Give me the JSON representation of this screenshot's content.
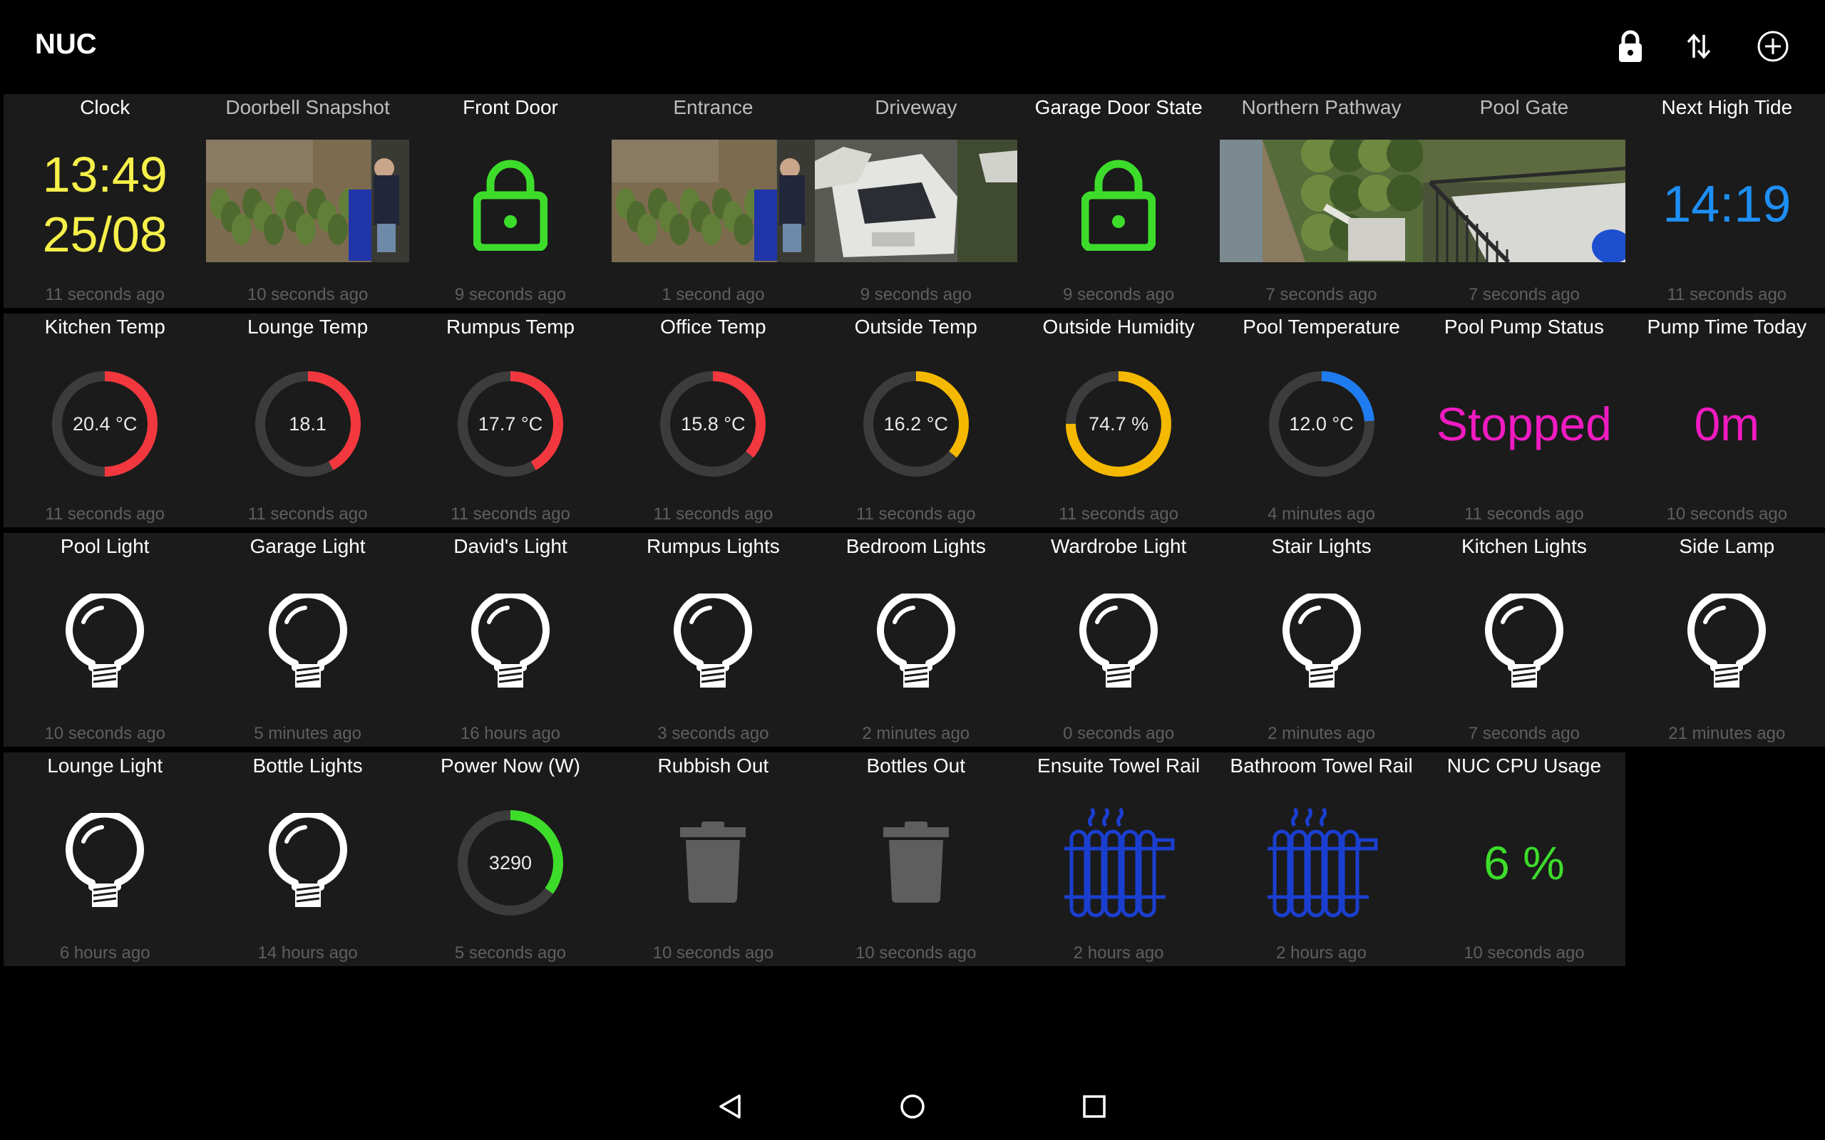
{
  "app": {
    "title": "NUC"
  },
  "toolbar": {
    "lock": "lock-icon",
    "sort": "swap-vertical-icon",
    "add": "plus-circle-icon"
  },
  "rows": [
    [
      {
        "type": "clock",
        "title": "Clock",
        "time": "13:49",
        "date": "25/08",
        "ago": "11 seconds ago",
        "color": "#f6f04a"
      },
      {
        "type": "camera",
        "title": "Doorbell Snapshot",
        "scene": "porch",
        "ago": "10 seconds ago"
      },
      {
        "type": "lock",
        "title": "Front Door",
        "state": "locked",
        "ago": "9 seconds ago",
        "color": "#3ddc2b"
      },
      {
        "type": "camera",
        "title": "Entrance",
        "scene": "porch",
        "ago": "1 second ago"
      },
      {
        "type": "camera",
        "title": "Driveway",
        "scene": "cars",
        "ago": "9 seconds ago"
      },
      {
        "type": "lock",
        "title": "Garage Door State",
        "state": "locked",
        "ago": "9 seconds ago",
        "color": "#3ddc2b"
      },
      {
        "type": "camera",
        "title": "Northern Pathway",
        "scene": "path",
        "ago": "7 seconds ago"
      },
      {
        "type": "camera",
        "title": "Pool Gate",
        "scene": "deck",
        "ago": "7 seconds ago"
      },
      {
        "type": "text",
        "title": "Next High Tide",
        "value": "14:19",
        "ago": "11 seconds ago",
        "color": "#1e8ff5",
        "size": 72
      }
    ],
    [
      {
        "type": "gauge",
        "title": "Kitchen Temp",
        "value": "20.4 °C",
        "fraction": 0.5,
        "color": "#f2383e",
        "ago": "11 seconds ago"
      },
      {
        "type": "gauge",
        "title": "Lounge Temp",
        "value": "18.1",
        "fraction": 0.42,
        "color": "#f2383e",
        "ago": "11 seconds ago"
      },
      {
        "type": "gauge",
        "title": "Rumpus Temp",
        "value": "17.7 °C",
        "fraction": 0.42,
        "color": "#f2383e",
        "ago": "11 seconds ago"
      },
      {
        "type": "gauge",
        "title": "Office Temp",
        "value": "15.8 °C",
        "fraction": 0.36,
        "color": "#f2383e",
        "ago": "11 seconds ago"
      },
      {
        "type": "gauge",
        "title": "Outside Temp",
        "value": "16.2 °C",
        "fraction": 0.36,
        "color": "#f5b800",
        "ago": "11 seconds ago"
      },
      {
        "type": "gauge",
        "title": "Outside Humidity",
        "value": "74.7 %",
        "fraction": 0.75,
        "color": "#f5b800",
        "ago": "11 seconds ago"
      },
      {
        "type": "gauge",
        "title": "Pool Temperature",
        "value": "12.0 °C",
        "fraction": 0.24,
        "color": "#1f7cf0",
        "ago": "4 minutes ago"
      },
      {
        "type": "text",
        "title": "Pool Pump Status",
        "value": "Stopped",
        "ago": "11 seconds ago",
        "color": "#f01bc0",
        "size": 66
      },
      {
        "type": "text",
        "title": "Pump Time Today",
        "value": "0m",
        "ago": "10 seconds ago",
        "color": "#f01bc0",
        "size": 66
      }
    ],
    [
      {
        "type": "bulb",
        "title": "Pool Light",
        "ago": "10 seconds ago"
      },
      {
        "type": "bulb",
        "title": "Garage Light",
        "ago": "5 minutes ago"
      },
      {
        "type": "bulb",
        "title": "David's Light",
        "ago": "16 hours ago"
      },
      {
        "type": "bulb",
        "title": "Rumpus Lights",
        "ago": "3 seconds ago"
      },
      {
        "type": "bulb",
        "title": "Bedroom Lights",
        "ago": "2 minutes ago"
      },
      {
        "type": "bulb",
        "title": "Wardrobe Light",
        "ago": "0 seconds ago"
      },
      {
        "type": "bulb",
        "title": "Stair Lights",
        "ago": "2 minutes ago"
      },
      {
        "type": "bulb",
        "title": "Kitchen Lights",
        "ago": "7 seconds ago"
      },
      {
        "type": "bulb",
        "title": "Side Lamp",
        "ago": "21 minutes ago"
      }
    ],
    [
      {
        "type": "bulb",
        "title": "Lounge Light",
        "ago": "6 hours ago"
      },
      {
        "type": "bulb",
        "title": "Bottle Lights",
        "ago": "14 hours ago"
      },
      {
        "type": "gauge",
        "title": "Power Now (W)",
        "value": "3290",
        "fraction": 0.35,
        "color": "#3ddc2b",
        "ago": "5 seconds ago"
      },
      {
        "type": "bin",
        "title": "Rubbish Out",
        "ago": "10 seconds ago"
      },
      {
        "type": "bin",
        "title": "Bottles Out",
        "ago": "10 seconds ago"
      },
      {
        "type": "radiator",
        "title": "Ensuite Towel Rail",
        "ago": "2 hours ago",
        "color": "#1a3fd0"
      },
      {
        "type": "radiator",
        "title": "Bathroom Towel Rail",
        "ago": "2 hours ago",
        "color": "#1a3fd0"
      },
      {
        "type": "text",
        "title": "NUC CPU Usage",
        "value": "6 %",
        "ago": "10 seconds ago",
        "color": "#3ddc2b",
        "size": 66
      },
      {
        "type": "blank"
      }
    ]
  ],
  "navbar": {
    "back": "back-triangle-icon",
    "home": "home-circle-icon",
    "recents": "recents-square-icon"
  }
}
